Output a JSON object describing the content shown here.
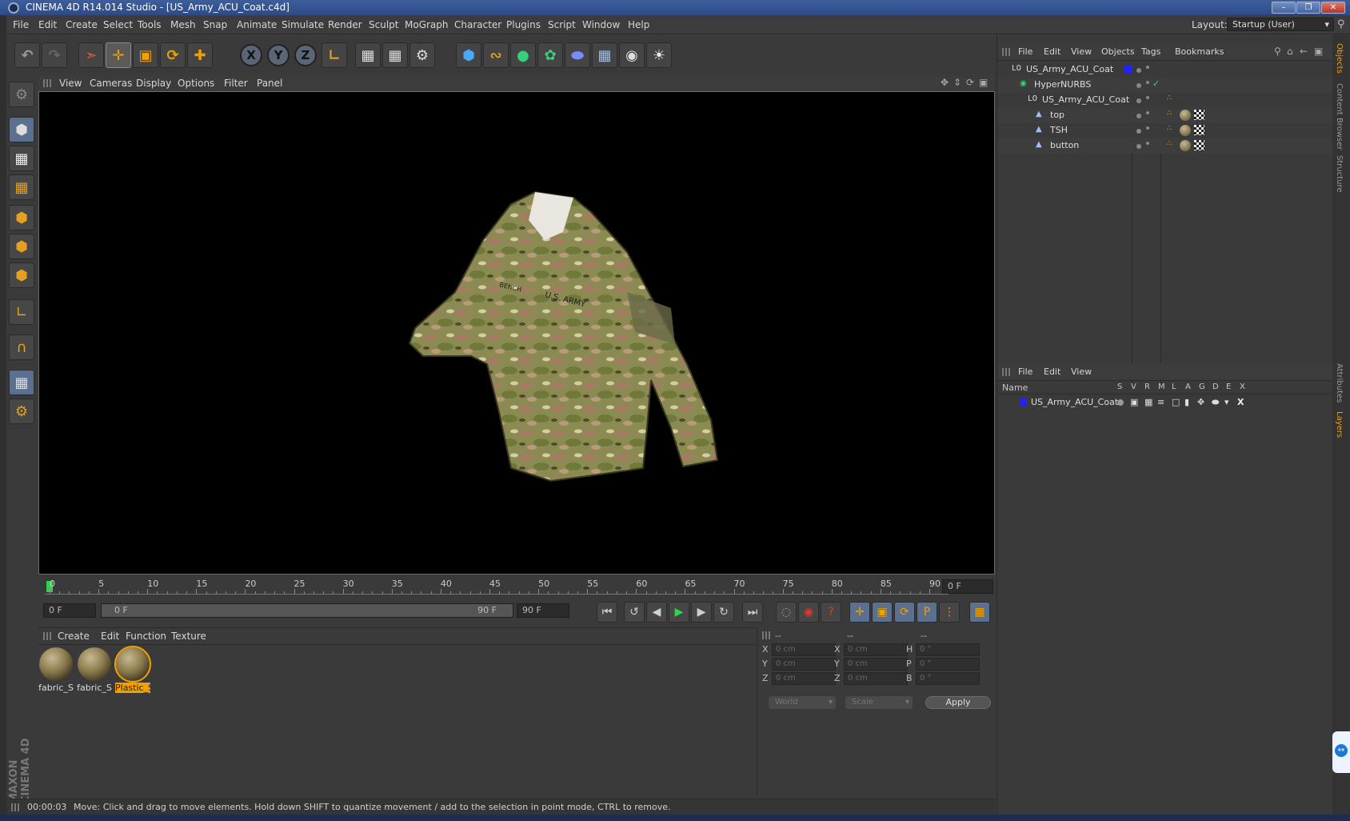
{
  "window": {
    "title": "CINEMA 4D R14.014 Studio - [US_Army_ACU_Coat.c4d]"
  },
  "menu": [
    "File",
    "Edit",
    "Create",
    "Select",
    "Tools",
    "Mesh",
    "Snap",
    "Animate",
    "Simulate",
    "Render",
    "Sculpt",
    "MoGraph",
    "Character",
    "Plugins",
    "Script",
    "Window",
    "Help"
  ],
  "layout": {
    "label": "Layout:",
    "value": "Startup (User)"
  },
  "viewport": {
    "menu": [
      "View",
      "Cameras",
      "Display",
      "Options",
      "Filter",
      "Panel"
    ],
    "patches": [
      "U.S. ARMY",
      "BENCH"
    ]
  },
  "timeline": {
    "ticks": [
      "0",
      "5",
      "10",
      "15",
      "20",
      "25",
      "30",
      "35",
      "40",
      "45",
      "50",
      "55",
      "60",
      "65",
      "70",
      "75",
      "80",
      "85",
      "90"
    ],
    "current_frame": "0 F",
    "start_field": "0 F",
    "range_start": "0 F",
    "range_end": "90 F",
    "end_field": "90 F"
  },
  "materials": {
    "menu": [
      "Create",
      "Edit",
      "Function",
      "Texture"
    ],
    "items": [
      {
        "label": "fabric_S",
        "selected": false
      },
      {
        "label": "fabric_S",
        "selected": false
      },
      {
        "label": "Plastic_S",
        "selected": true
      }
    ]
  },
  "coords": {
    "headers": [
      "--",
      "--",
      "--"
    ],
    "rows": [
      {
        "a": "X",
        "v1": "0 cm",
        "b": "X",
        "v2": "0 cm",
        "c": "H",
        "v3": "0 °"
      },
      {
        "a": "Y",
        "v1": "0 cm",
        "b": "Y",
        "v2": "0 cm",
        "c": "P",
        "v3": "0 °"
      },
      {
        "a": "Z",
        "v1": "0 cm",
        "b": "Z",
        "v2": "0 cm",
        "c": "B",
        "v3": "0 °"
      }
    ],
    "mode": "World",
    "scale": "Scale",
    "apply": "Apply"
  },
  "status": {
    "time": "00:00:03",
    "message": "Move: Click and drag to move elements. Hold down SHIFT to quantize movement / add to the selection in point mode, CTRL to remove."
  },
  "objects": {
    "menu": [
      "File",
      "Edit",
      "View",
      "Objects",
      "Tags",
      "Bookmarks"
    ],
    "tree": [
      {
        "name": "US_Army_ACU_Coat",
        "indent": 0
      },
      {
        "name": "HyperNURBS",
        "indent": 1
      },
      {
        "name": "US_Army_ACU_Coat",
        "indent": 2
      },
      {
        "name": "top",
        "indent": 3
      },
      {
        "name": "TSH",
        "indent": 3
      },
      {
        "name": "button",
        "indent": 3
      }
    ]
  },
  "layers": {
    "menu": [
      "File",
      "Edit",
      "View"
    ],
    "name_header": "Name",
    "col_headers": [
      "S",
      "V",
      "R",
      "M",
      "L",
      "A",
      "G",
      "D",
      "E",
      "X"
    ],
    "rows": [
      {
        "name": "US_Army_ACU_Coat"
      }
    ]
  },
  "right_tabs": [
    "Objects",
    "Content Browser",
    "Structure",
    "Attributes",
    "Layers"
  ],
  "brand": "MAXON CINEMA 4D",
  "colors": {
    "accent": "#e6a020",
    "layer_color": "#2222ff",
    "selection": "#f0a000"
  }
}
